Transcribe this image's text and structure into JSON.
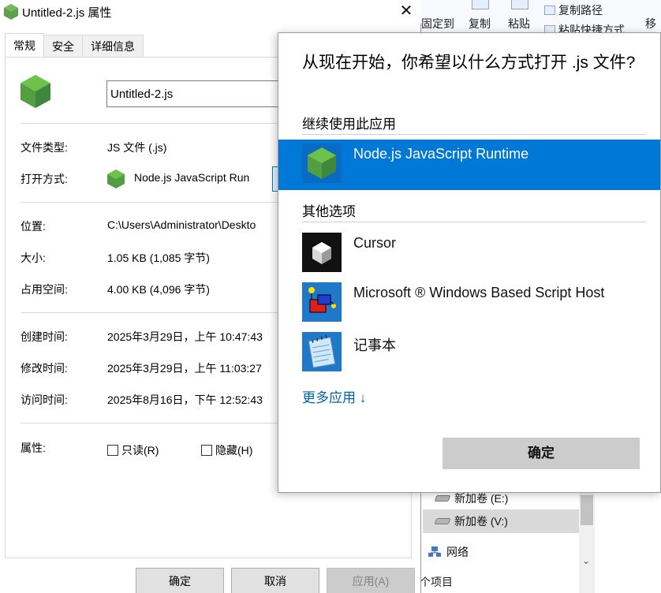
{
  "explorer": {
    "ribbon": {
      "pin": "固定到",
      "copy": "复制",
      "paste": "粘贴",
      "copy_path": "复制路径",
      "paste_shortcut": "粘贴快捷方式",
      "move": "移"
    },
    "nav": {
      "drive_e": "新加卷 (E:)",
      "drive_v": "新加卷 (V:)",
      "network": "网络"
    },
    "status": "个项目"
  },
  "props": {
    "title": "Untitled-2.js 属性",
    "close_symbol": "✕",
    "tabs": [
      "常规",
      "安全",
      "详细信息"
    ],
    "filename": "Untitled-2.js",
    "file_type_label": "文件类型:",
    "file_type_value": "JS 文件 (.js)",
    "open_with_label": "打开方式:",
    "open_with_value": "Node.js JavaScript Run",
    "location_label": "位置:",
    "location_value": "C:\\Users\\Administrator\\Deskto",
    "size_label": "大小:",
    "size_value": "1.05 KB (1,085 字节)",
    "disk_size_label": "占用空间:",
    "disk_size_value": "4.00 KB (4,096 字节)",
    "created_label": "创建时间:",
    "created_value": "2025年3月29日，上午 10:47:43",
    "modified_label": "修改时间:",
    "modified_value": "2025年3月29日，上午 11:03:27",
    "accessed_label": "访问时间:",
    "accessed_value": "2025年8月16日，下午 12:52:43",
    "attributes_label": "属性:",
    "readonly_label": "只读(R)",
    "hidden_label": "隐藏(H)",
    "ok_label": "确定",
    "cancel_label": "取消",
    "apply_label": "应用(A)"
  },
  "flyout": {
    "title": "从现在开始，你希望以什么方式打开 .js 文件?",
    "continue_heading": "继续使用此应用",
    "other_heading": "其他选项",
    "apps": [
      {
        "name": "Node.js JavaScript Runtime",
        "icon": "nodejs-icon"
      },
      {
        "name": "Cursor",
        "icon": "cursor-icon"
      },
      {
        "name": "Microsoft ® Windows Based Script Host",
        "icon": "script-host-icon"
      },
      {
        "name": "记事本",
        "icon": "notepad-icon"
      }
    ],
    "more_apps": "更多应用 ↓",
    "ok_label": "确定"
  },
  "colors": {
    "accent": "#0078d7",
    "link": "#0063b1",
    "node_green": "#5fa04e"
  }
}
